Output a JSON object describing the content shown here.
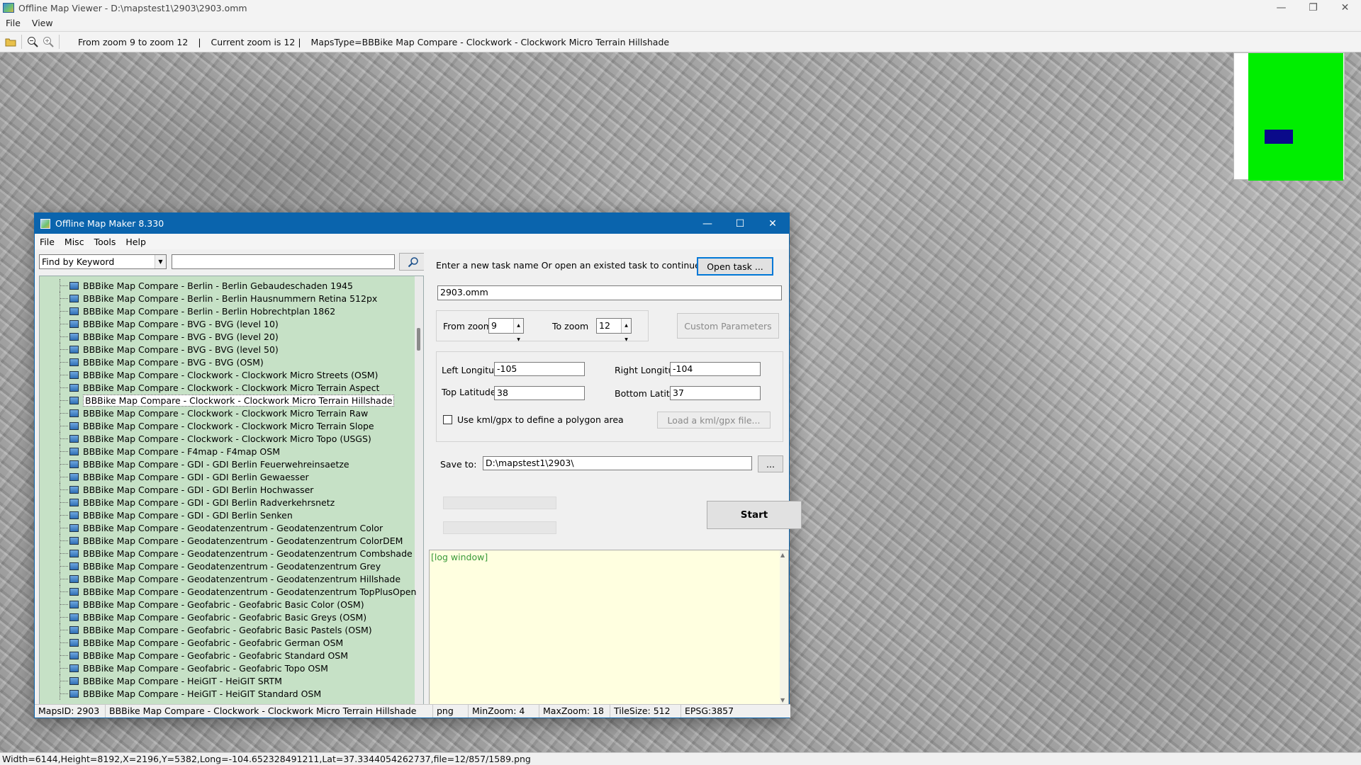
{
  "window": {
    "title": "Offline Map Viewer - D:\\mapstest1\\2903\\2903.omm",
    "menu": [
      "File",
      "View"
    ]
  },
  "toolbar": {
    "zoom_range": "From zoom 9 to zoom 12",
    "current_zoom": "Current zoom is 12",
    "maps_type": "MapsType=BBBike Map Compare - Clockwork - Clockwork Micro Terrain Hillshade",
    "icons": [
      "open-folder-icon",
      "zoom-out-icon",
      "zoom-in-icon"
    ]
  },
  "status_line": "Width=6144,Height=8192,X=2196,Y=5382,Long=-104.652328491211,Lat=37.3344054262737,file=12/857/1589.png",
  "minimap": {
    "land_color": "#00ee00",
    "view_color": "#0a0a8a"
  },
  "dialog": {
    "title": "Offline Map Maker 8.330",
    "menu": [
      "File",
      "Misc",
      "Tools",
      "Help"
    ],
    "find_mode": "Find by Keyword",
    "find_text": "",
    "tree_items": [
      "BBBike Map Compare - Berlin - Berlin Gebaudeschaden 1945",
      "BBBike Map Compare - Berlin - Berlin Hausnummern Retina 512px",
      "BBBike Map Compare - Berlin - Berlin Hobrechtplan 1862",
      "BBBike Map Compare - BVG - BVG (level 10)",
      "BBBike Map Compare - BVG - BVG (level 20)",
      "BBBike Map Compare - BVG - BVG (level 50)",
      "BBBike Map Compare - BVG - BVG (OSM)",
      "BBBike Map Compare - Clockwork - Clockwork Micro Streets (OSM)",
      "BBBike Map Compare - Clockwork - Clockwork Micro Terrain Aspect",
      "BBBike Map Compare - Clockwork - Clockwork Micro Terrain Hillshade",
      "BBBike Map Compare - Clockwork - Clockwork Micro Terrain Raw",
      "BBBike Map Compare - Clockwork - Clockwork Micro Terrain Slope",
      "BBBike Map Compare - Clockwork - Clockwork Micro Topo (USGS)",
      "BBBike Map Compare - F4map - F4map OSM",
      "BBBike Map Compare - GDI - GDI Berlin Feuerwehreinsaetze",
      "BBBike Map Compare - GDI - GDI Berlin Gewaesser",
      "BBBike Map Compare - GDI - GDI Berlin Hochwasser",
      "BBBike Map Compare - GDI - GDI Berlin Radverkehrsnetz",
      "BBBike Map Compare - GDI - GDI Berlin Senken",
      "BBBike Map Compare - Geodatenzentrum - Geodatenzentrum Color",
      "BBBike Map Compare - Geodatenzentrum - Geodatenzentrum ColorDEM",
      "BBBike Map Compare - Geodatenzentrum - Geodatenzentrum Combshade",
      "BBBike Map Compare - Geodatenzentrum - Geodatenzentrum Grey",
      "BBBike Map Compare - Geodatenzentrum - Geodatenzentrum Hillshade",
      "BBBike Map Compare - Geodatenzentrum - Geodatenzentrum TopPlusOpen",
      "BBBike Map Compare - Geofabric - Geofabric Basic Color (OSM)",
      "BBBike Map Compare - Geofabric - Geofabric Basic Greys (OSM)",
      "BBBike Map Compare - Geofabric - Geofabric Basic Pastels (OSM)",
      "BBBike Map Compare - Geofabric - Geofabric German OSM",
      "BBBike Map Compare - Geofabric - Geofabric Standard OSM",
      "BBBike Map Compare - Geofabric - Geofabric Topo OSM",
      "BBBike Map Compare - HeiGIT - HeiGIT SRTM",
      "BBBike Map Compare - HeiGIT - HeiGIT Standard OSM"
    ],
    "selected_index": 9,
    "task_prompt": "Enter a new task name Or open an existed task to continue:",
    "open_task_label": "Open task ...",
    "task_name": "2903.omm",
    "from_zoom_label": "From zoom",
    "from_zoom": "9",
    "to_zoom_label": "To zoom",
    "to_zoom": "12",
    "custom_params_label": "Custom Parameters",
    "left_lon_label": "Left Longitude",
    "left_lon": "-105",
    "right_lon_label": "Right Longitude",
    "right_lon": "-104",
    "top_lat_label": "Top Latitude",
    "top_lat": "38",
    "bottom_lat_label": "Bottom Latitude",
    "bottom_lat": "37",
    "kml_label": "Use kml/gpx to define a polygon area",
    "load_kml_label": "Load a kml/gpx file...",
    "save_to_label": "Save to:",
    "save_to": "D:\\mapstest1\\2903\\",
    "browse_label": "...",
    "start_label": "Start",
    "log_text": "[log window]",
    "status": {
      "maps_id": "MapsID: 2903",
      "maps_name": "BBBike Map Compare - Clockwork - Clockwork Micro Terrain Hillshade",
      "format": "png",
      "min_zoom": "MinZoom: 4",
      "max_zoom": "MaxZoom: 18",
      "tile_size": "TileSize: 512",
      "epsg": "EPSG:3857"
    }
  }
}
